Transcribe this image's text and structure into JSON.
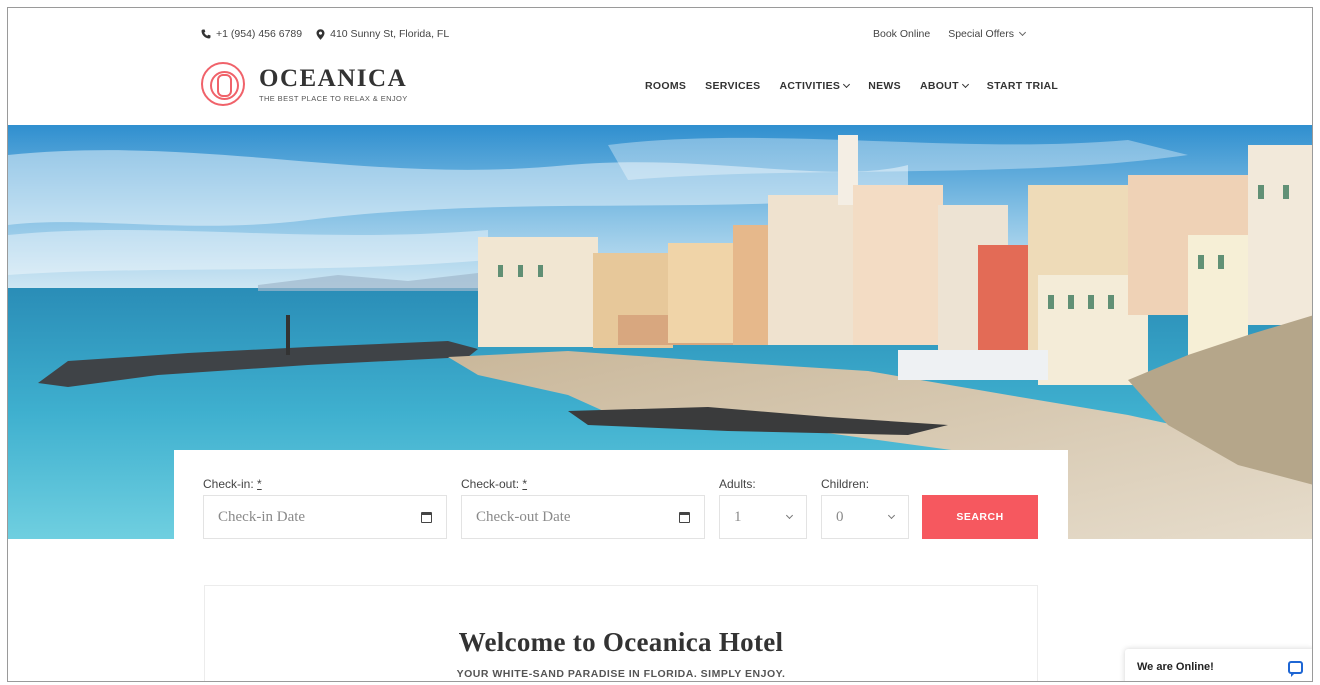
{
  "topbar": {
    "phone": "+1 (954) 456 6789",
    "address": "410 Sunny St, Florida, FL",
    "book_online": "Book Online",
    "special_offers": "Special Offers"
  },
  "logo": {
    "name": "OCEANICA",
    "tagline": "THE BEST PLACE TO RELAX & ENJOY"
  },
  "nav": {
    "items": [
      {
        "label": "ROOMS"
      },
      {
        "label": "SERVICES"
      },
      {
        "label": "ACTIVITIES"
      },
      {
        "label": "NEWS"
      },
      {
        "label": "ABOUT"
      },
      {
        "label": "START TRIAL"
      }
    ]
  },
  "booking": {
    "checkin_label": "Check-in:",
    "checkout_label": "Check-out:",
    "required_mark": "*",
    "checkin_placeholder": "Check-in Date",
    "checkout_placeholder": "Check-out Date",
    "adults_label": "Adults:",
    "adults_value": "1",
    "children_label": "Children:",
    "children_value": "0",
    "search_label": "SEARCH"
  },
  "welcome": {
    "title": "Welcome to Oceanica Hotel",
    "subtitle": "YOUR WHITE-SAND PARADISE IN FLORIDA. SIMPLY ENJOY."
  },
  "chat": {
    "label": "We are Online!"
  },
  "colors": {
    "accent": "#f6585f",
    "chat_blue": "#1e66d4"
  }
}
